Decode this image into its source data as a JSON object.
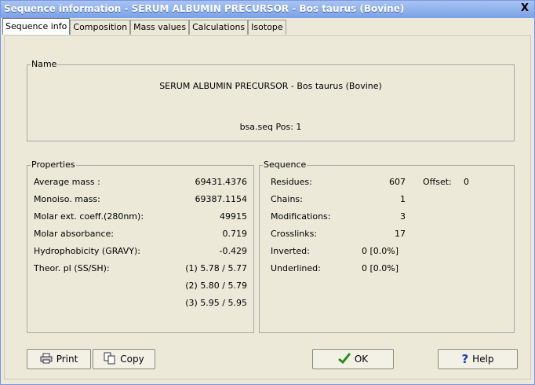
{
  "window": {
    "title": "Sequence information  -  SERUM ALBUMIN PRECURSOR - Bos taurus (Bovine)",
    "close_label": "X"
  },
  "tabs": [
    {
      "label": "Sequence info",
      "active": true
    },
    {
      "label": "Composition"
    },
    {
      "label": "Mass values"
    },
    {
      "label": "Calculations"
    },
    {
      "label": "Isotope"
    }
  ],
  "name_box": {
    "legend": "Name",
    "name": "SERUM ALBUMIN PRECURSOR - Bos taurus (Bovine)",
    "file_pos": "bsa.seq  Pos: 1"
  },
  "properties": {
    "legend": "Properties",
    "rows": [
      {
        "label": "Average mass :",
        "value": "69431.4376"
      },
      {
        "label": "Monoiso. mass:",
        "value": "69387.1154"
      },
      {
        "label": "Molar ext. coeff.(280nm):",
        "value": "49915"
      },
      {
        "label": "Molar absorbance:",
        "value": "0.719"
      },
      {
        "label": "Hydrophobicity (GRAVY):",
        "value": "-0.429"
      },
      {
        "label": "Theor. pI (SS/SH):",
        "value": "(1)  5.78 / 5.77"
      }
    ],
    "pi_extra": [
      "(2)  5.80 / 5.79",
      "(3)  5.95 / 5.95"
    ]
  },
  "sequence": {
    "legend": "Sequence",
    "rows": [
      {
        "label": "Residues:",
        "value": "607"
      },
      {
        "label": "Chains:",
        "value": "1"
      },
      {
        "label": "Modifications:",
        "value": "3"
      },
      {
        "label": "Crosslinks:",
        "value": "17"
      },
      {
        "label": "Inverted:",
        "value": "0 [0.0%]"
      },
      {
        "label": "Underlined:",
        "value": "0 [0.0%]"
      }
    ],
    "offset_label": "Offset:",
    "offset_value": "0"
  },
  "buttons": {
    "print": "Print",
    "copy": "Copy",
    "ok": "OK",
    "help": "Help"
  },
  "colors": {
    "title_bg": "#7aa1e6",
    "panel_bg": "#ece9d8",
    "ok_check": "#2e8b1e",
    "help_mark": "#1a3fb0"
  }
}
